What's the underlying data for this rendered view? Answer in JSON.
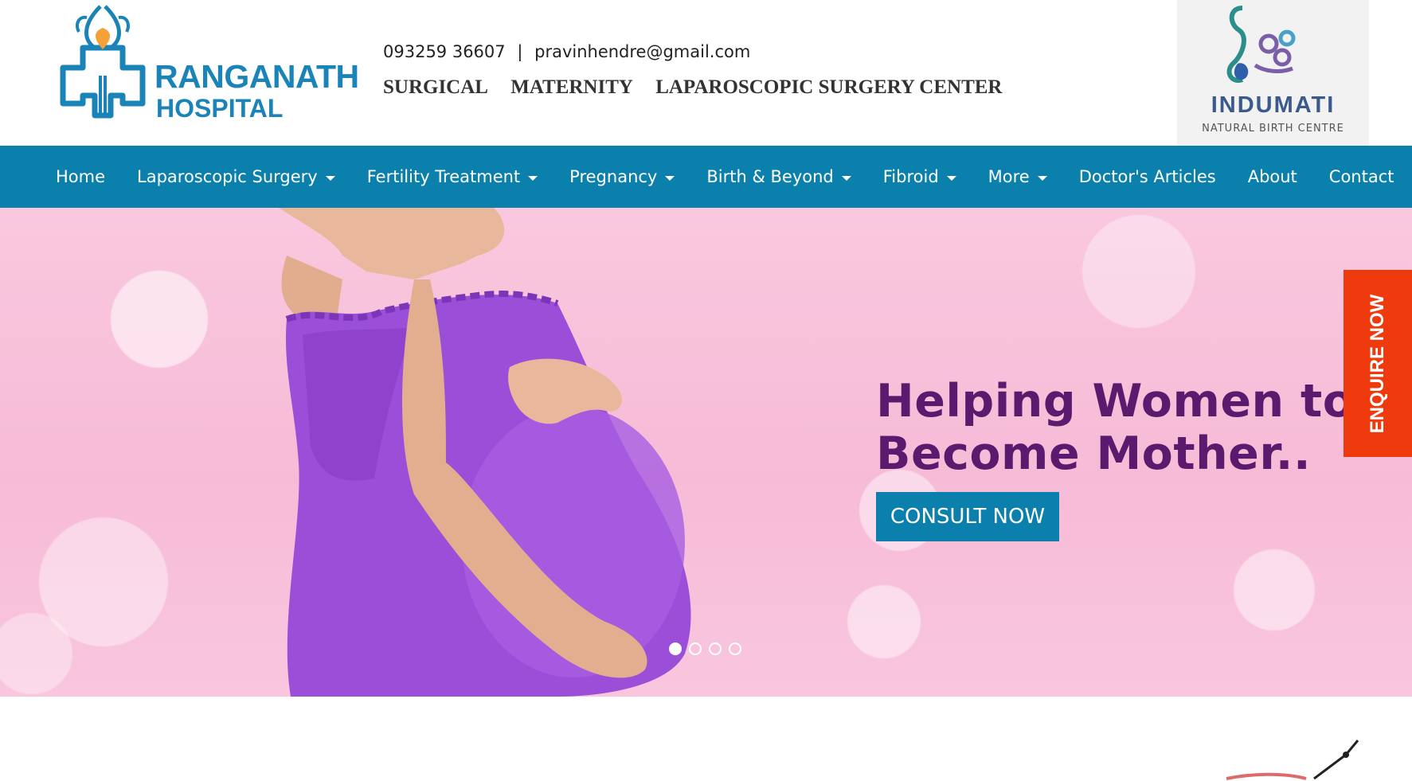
{
  "header": {
    "logo": {
      "line1": "RANGANATH",
      "line2": "HOSPITAL"
    },
    "phone": "093259 36607",
    "separator": "|",
    "email": "pravinhendre@gmail.com",
    "services": [
      "SURGICAL",
      "MATERNITY",
      "LAPAROSCOPIC SURGERY CENTER"
    ],
    "partner": {
      "name": "INDUMATI",
      "subtitle": "NATURAL BIRTH CENTRE"
    }
  },
  "nav": {
    "items": [
      {
        "label": "Home",
        "dropdown": false
      },
      {
        "label": "Laparoscopic Surgery",
        "dropdown": true
      },
      {
        "label": "Fertility Treatment",
        "dropdown": true
      },
      {
        "label": "Pregnancy",
        "dropdown": true
      },
      {
        "label": "Birth & Beyond",
        "dropdown": true
      },
      {
        "label": "Fibroid",
        "dropdown": true
      },
      {
        "label": "More",
        "dropdown": true
      },
      {
        "label": "Doctor's Articles",
        "dropdown": false
      },
      {
        "label": "About",
        "dropdown": false
      },
      {
        "label": "Contact",
        "dropdown": false
      }
    ]
  },
  "hero": {
    "headline_line1": "Helping Women to",
    "headline_line2": "Become Mother..",
    "button": "CONSULT NOW",
    "slides": 4,
    "active_slide": 1
  },
  "enquire": {
    "label": "ENQUIRE NOW"
  },
  "colors": {
    "brand_blue": "#0b80ad",
    "headline_purple": "#5b1a6e",
    "enquire_orange": "#ee3a0c",
    "hero_pink": "#f7bbd7"
  }
}
